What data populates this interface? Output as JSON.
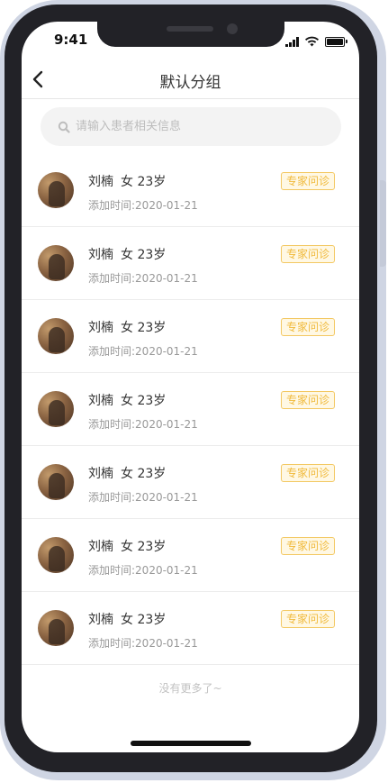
{
  "status_bar": {
    "time": "9:41"
  },
  "navbar": {
    "title": "默认分组"
  },
  "search": {
    "placeholder": "请输入患者相关信息"
  },
  "patients": [
    {
      "name": "刘楠",
      "gender_age": "女 23岁",
      "added": "添加时间:2020-01-21",
      "tag": "专家问诊"
    },
    {
      "name": "刘楠",
      "gender_age": "女 23岁",
      "added": "添加时间:2020-01-21",
      "tag": "专家问诊"
    },
    {
      "name": "刘楠",
      "gender_age": "女 23岁",
      "added": "添加时间:2020-01-21",
      "tag": "专家问诊"
    },
    {
      "name": "刘楠",
      "gender_age": "女 23岁",
      "added": "添加时间:2020-01-21",
      "tag": "专家问诊"
    },
    {
      "name": "刘楠",
      "gender_age": "女 23岁",
      "added": "添加时间:2020-01-21",
      "tag": "专家问诊"
    },
    {
      "name": "刘楠",
      "gender_age": "女 23岁",
      "added": "添加时间:2020-01-21",
      "tag": "专家问诊"
    },
    {
      "name": "刘楠",
      "gender_age": "女 23岁",
      "added": "添加时间:2020-01-21",
      "tag": "专家问诊"
    }
  ],
  "footer": {
    "note": "没有更多了~"
  },
  "icons": {
    "back": "chevron-left-icon",
    "search": "search-icon",
    "signal": "cellular-signal-icon",
    "wifi": "wifi-icon",
    "battery": "battery-icon"
  },
  "colors": {
    "tag_text": "#f0b93a",
    "tag_border": "#f3c862",
    "tag_bg": "#fff8e4"
  }
}
